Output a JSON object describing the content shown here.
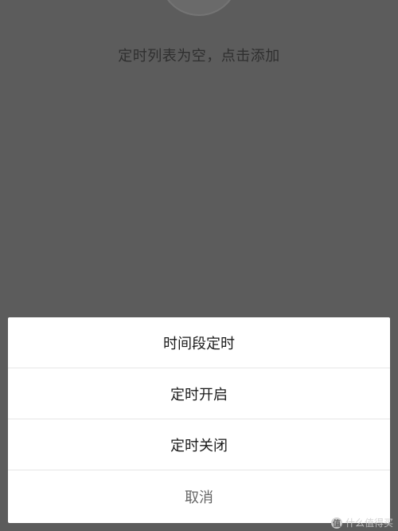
{
  "background": {
    "overlay_color": "#5c5c5c"
  },
  "empty_state": {
    "illustration_icon": "empty-timer-icon",
    "message": "定时列表为空，点击添加"
  },
  "action_sheet": {
    "items": [
      {
        "label": "时间段定时"
      },
      {
        "label": "定时开启"
      },
      {
        "label": "定时关闭"
      }
    ],
    "cancel_label": "取消"
  },
  "watermark": {
    "text": "什么值得买"
  }
}
